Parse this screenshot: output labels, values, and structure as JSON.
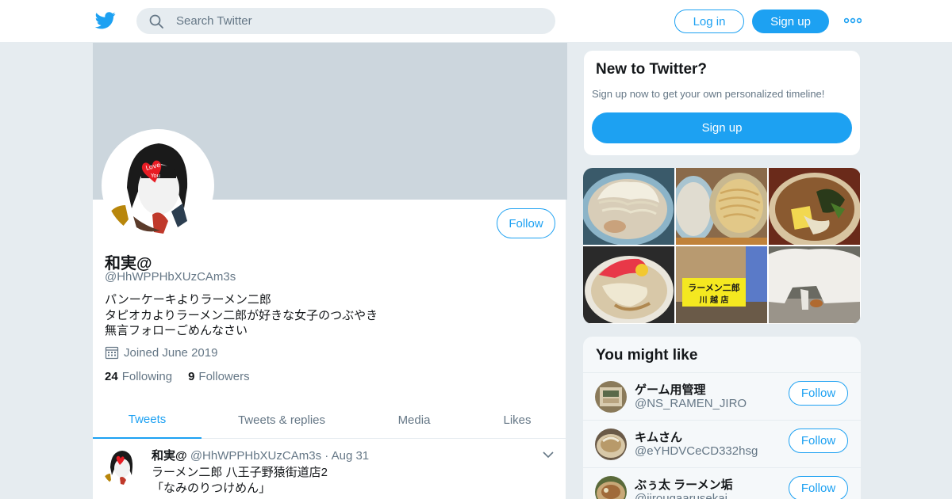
{
  "header": {
    "search_placeholder": "Search Twitter",
    "login_label": "Log in",
    "signup_label": "Sign up",
    "brand_color": "#1da1f2"
  },
  "profile": {
    "name": "和実@",
    "handle": "@HhWPPHbXUzCAm3s",
    "follow_label": "Follow",
    "bio": [
      "パンーケーキよりラーメン二郎",
      "タピオカよりラーメン二郎が好きな女子のつぶやき",
      "無言フォローごめんなさい"
    ],
    "joined": "Joined June 2019",
    "following_count": "24",
    "following_label": "Following",
    "followers_count": "9",
    "followers_label": "Followers",
    "tabs": [
      "Tweets",
      "Tweets & replies",
      "Media",
      "Likes"
    ],
    "active_tab": "Tweets"
  },
  "tweet": {
    "name": "和実@",
    "handle": "@HhWPPHbXUzCAm3s",
    "separator": "·",
    "date": "Aug 31",
    "lines": [
      "ラーメン二郎 八王子野猿街道店2",
      "「なみのりつけめん」"
    ]
  },
  "new_to_twitter": {
    "title": "New to Twitter?",
    "subtitle": "Sign up now to get your own personalized timeline!",
    "button": "Sign up"
  },
  "media": {
    "sign_text_line1": "ラーメン二郎",
    "sign_text_line2": "川 越 店"
  },
  "you_might_like": {
    "title": "You might like",
    "accounts": [
      {
        "name": "ゲーム用管理",
        "handle": "@NS_RAMEN_JIRO",
        "button": "Follow"
      },
      {
        "name": "キムさん",
        "handle": "@eYHDVCeCD332hsg",
        "button": "Follow"
      },
      {
        "name": "ぶぅ太 ラーメン垢",
        "handle": "@jirougaarusekai",
        "button": "Follow"
      }
    ]
  }
}
